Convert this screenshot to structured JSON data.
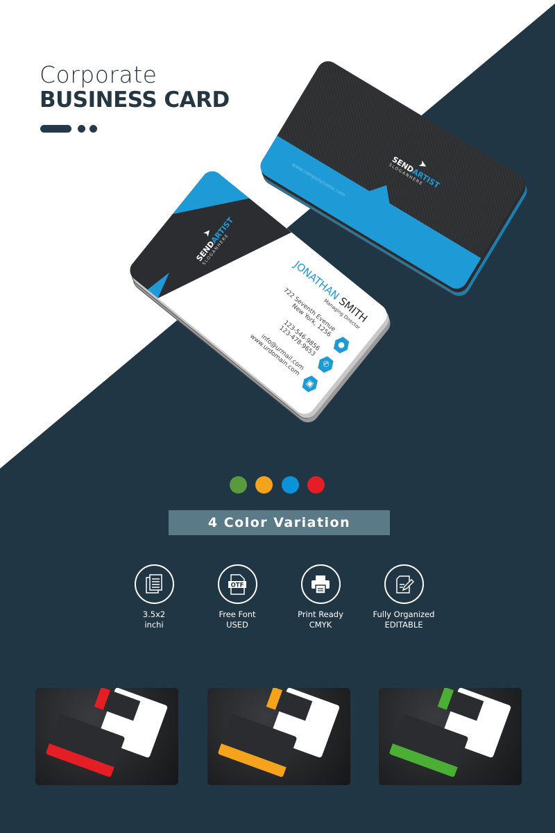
{
  "header": {
    "title_light": "Corporate",
    "title_bold": "BUSINESS CARD"
  },
  "card": {
    "brand_a": "SEND",
    "brand_b": "ARTIST",
    "slogan": "SLOGANHERE",
    "website_back": "www.companyname.com",
    "first_name": "JONATHAN",
    "last_name": "SMITH",
    "role": "Managing Director",
    "address1": "722 Seventh Evenue",
    "address2": "New York, 1256",
    "phone1": "123-546-9856",
    "phone2": "123-478-9653",
    "email": "info@urmail.com",
    "website": "www.urdomain.com",
    "icons": [
      "location-pin-icon",
      "phone-icon",
      "web-icon"
    ],
    "accent": "#1e9ad6"
  },
  "variations": {
    "colors": [
      "#5a9a3e",
      "#f5a31a",
      "#0a93d9",
      "#e31e24"
    ],
    "label": "4 Color Variation"
  },
  "features": [
    {
      "icon": "document-icon",
      "line1": "3.5x2",
      "line2": "inchi"
    },
    {
      "icon": "otf-file-icon",
      "line1": "Free Font",
      "line2": "USED"
    },
    {
      "icon": "printer-icon",
      "line1": "Print Ready",
      "line2": "CMYK"
    },
    {
      "icon": "edit-document-icon",
      "line1": "Fully Organized",
      "line2": "EDITABLE"
    }
  ],
  "thumbnails": [
    {
      "color": "#e31e24"
    },
    {
      "color": "#f5a31a"
    },
    {
      "color": "#4caf35"
    }
  ],
  "colors": {
    "background": "#213645",
    "banner": "#597a86"
  }
}
